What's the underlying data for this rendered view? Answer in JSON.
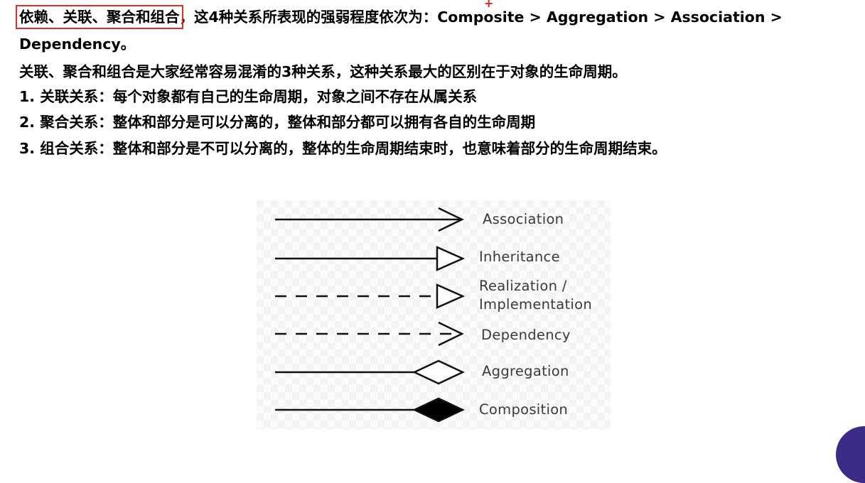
{
  "intro": {
    "highlight": "依赖、关联、聚合和组合",
    "rest": "，这4种关系所表现的强弱程度依次为：Composite > Aggregation > Association >",
    "continued": "Dependency。",
    "marker": "+"
  },
  "summary": "关联、聚合和组合是大家经常容易混淆的3种关系，这种关系最大的区别在于对象的生命周期。",
  "points": [
    "1. 关联关系：每个对象都有自己的生命周期，对象之间不存在从属关系",
    "2. 聚合关系：整体和部分是可以分离的，整体和部分都可以拥有各自的生命周期",
    "3. 组合关系：整体和部分是不可以分离的，整体的生命周期结束时，也意味着部分的生命周期结束。"
  ],
  "legend": {
    "association": "Association",
    "inheritance": "Inheritance",
    "realization_1": "Realization /",
    "realization_2": "Implementation",
    "dependency": "Dependency",
    "aggregation": "Aggregation",
    "composition": "Composition"
  },
  "colors": {
    "highlight_border": "#d9322d",
    "marker": "#e02020",
    "corner_accent": "#3b2a86"
  }
}
